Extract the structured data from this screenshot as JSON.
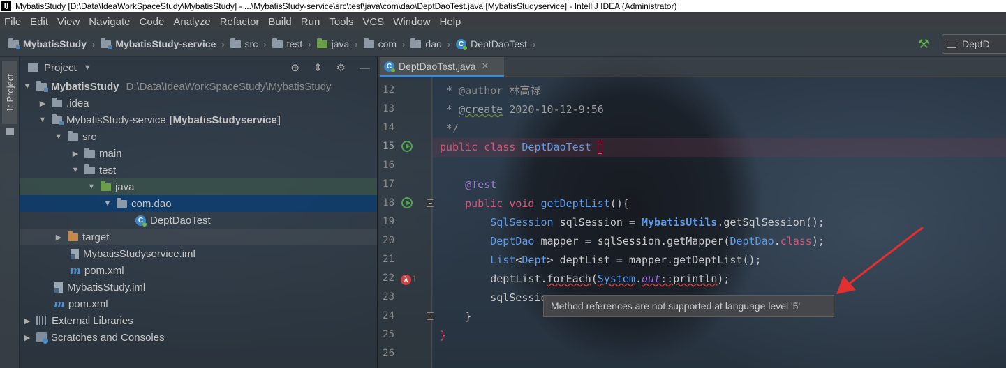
{
  "window": {
    "title": "MybatisStudy [D:\\Data\\IdeaWorkSpaceStudy\\MybatisStudy] - ...\\MybatisStudy-service\\src\\test\\java\\com\\dao\\DeptDaoTest.java [MybatisStudyservice] - IntelliJ IDEA (Administrator)",
    "app_icon": "IJ"
  },
  "menu": [
    "File",
    "Edit",
    "View",
    "Navigate",
    "Code",
    "Analyze",
    "Refactor",
    "Build",
    "Run",
    "Tools",
    "VCS",
    "Window",
    "Help"
  ],
  "breadcrumbs": [
    "MybatisStudy",
    "MybatisStudy-service",
    "src",
    "test",
    "java",
    "com",
    "dao",
    "DeptDaoTest"
  ],
  "run_config": {
    "label": "DeptD"
  },
  "left_stripe": {
    "tab": "1: Project"
  },
  "project_panel": {
    "title": "Project",
    "tree": [
      {
        "label": "MybatisStudy",
        "path": "D:\\Data\\IdeaWorkSpaceStudy\\MybatisStudy"
      },
      {
        "label": ".idea"
      },
      {
        "label": "MybatisStudy-service",
        "extra": "[MybatisStudyservice]"
      },
      {
        "label": "src"
      },
      {
        "label": "main"
      },
      {
        "label": "test"
      },
      {
        "label": "java"
      },
      {
        "label": "com.dao"
      },
      {
        "label": "DeptDaoTest"
      },
      {
        "label": "target"
      },
      {
        "label": "MybatisStudyservice.iml"
      },
      {
        "label": "pom.xml"
      },
      {
        "label": "MybatisStudy.iml"
      },
      {
        "label": "pom.xml"
      },
      {
        "label": "External Libraries"
      },
      {
        "label": "Scratches and Consoles"
      }
    ]
  },
  "editor": {
    "tab": "DeptDaoTest.java",
    "line_numbers": [
      "12",
      "13",
      "14",
      "15",
      "16",
      "17",
      "18",
      "19",
      "20",
      "21",
      "22",
      "23",
      "24",
      "25",
      "26"
    ],
    "code": {
      "l12_a": " * ",
      "l12_tag": "@author",
      "l12_b": " 林高禄",
      "l13_a": " * ",
      "l13_tag": "@create",
      "l13_b": " 2020-10-12-9:56",
      "l14": " */",
      "l15_kw": "public class ",
      "l15_cls": "DeptDaoTest",
      "l15_b": " ",
      "l17": "    @Test",
      "l18_kw": "    public void ",
      "l18_m": "getDeptList",
      "l18_b": "(){",
      "l19_cls": "        SqlSession",
      "l19_a": " sqlSession = ",
      "l19_cls2": "MybatisUtils",
      "l19_b": ".",
      "l19_m": "getSqlSession",
      "l19_c": "();",
      "l20_cls": "        DeptDao",
      "l20_a": " mapper = sqlSession.",
      "l20_m": "getMapper",
      "l20_b": "(",
      "l20_cls2": "DeptDao",
      "l20_c": ".",
      "l20_kw": "class",
      "l20_d": ");",
      "l21_cls": "        List",
      "l21_a": "<",
      "l21_cls2": "Dept",
      "l21_b": "> deptList = mapper.",
      "l21_m": "getDeptList",
      "l21_c": "();",
      "l22_a": "        deptList.",
      "l22_m": "forEach",
      "l22_b": "(",
      "l22_cls": "System",
      "l22_c": ".",
      "l22_fld": "out",
      "l22_d": "::",
      "l22_m2": "println",
      "l22_e": ");",
      "l23": "        sqlSessio",
      "l24": "    }",
      "l25": "}"
    }
  },
  "tooltip": {
    "text": "Method references are not supported at language level '5'"
  },
  "colors": {
    "accent_tab": "#4a88c7",
    "keyword": "#d4577b",
    "class": "#5f9ae8",
    "annotation_arrow": "#e03030"
  }
}
